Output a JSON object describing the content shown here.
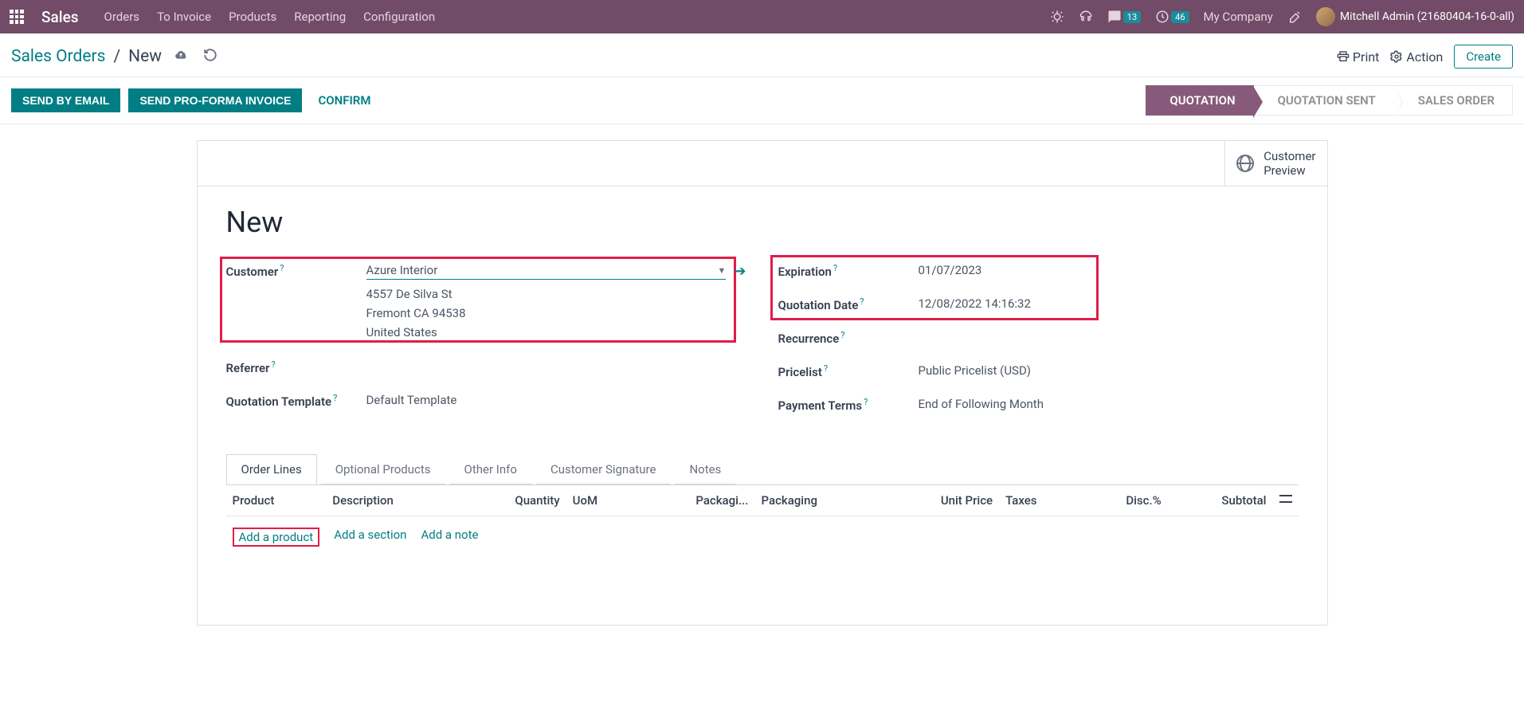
{
  "navbar": {
    "brand": "Sales",
    "links": [
      "Orders",
      "To Invoice",
      "Products",
      "Reporting",
      "Configuration"
    ],
    "chat_count": "13",
    "clock_count": "46",
    "company": "My Company",
    "user": "Mitchell Admin (21680404-16-0-all)"
  },
  "breadcrumb": {
    "root": "Sales Orders",
    "current": "New",
    "print": "Print",
    "action": "Action",
    "create": "Create"
  },
  "actions": {
    "send_email": "SEND BY EMAIL",
    "proforma": "SEND PRO-FORMA INVOICE",
    "confirm": "CONFIRM"
  },
  "status": {
    "steps": [
      "QUOTATION",
      "QUOTATION SENT",
      "SALES ORDER"
    ],
    "active": 0
  },
  "preview": {
    "line1": "Customer",
    "line2": "Preview"
  },
  "form": {
    "title": "New",
    "customer_label": "Customer",
    "customer_value": "Azure Interior",
    "address_line1": "4557 De Silva St",
    "address_line2": "Fremont CA 94538",
    "address_line3": "United States",
    "referrer_label": "Referrer",
    "template_label": "Quotation Template",
    "template_value": "Default Template",
    "expiration_label": "Expiration",
    "expiration_value": "01/07/2023",
    "quotation_date_label": "Quotation Date",
    "quotation_date_value": "12/08/2022 14:16:32",
    "recurrence_label": "Recurrence",
    "pricelist_label": "Pricelist",
    "pricelist_value": "Public Pricelist (USD)",
    "payment_terms_label": "Payment Terms",
    "payment_terms_value": "End of Following Month"
  },
  "tabs": [
    "Order Lines",
    "Optional Products",
    "Other Info",
    "Customer Signature",
    "Notes"
  ],
  "table": {
    "headers": {
      "product": "Product",
      "description": "Description",
      "quantity": "Quantity",
      "uom": "UoM",
      "packaging_qty": "Packagi...",
      "packaging": "Packaging",
      "unit_price": "Unit Price",
      "taxes": "Taxes",
      "disc": "Disc.%",
      "subtotal": "Subtotal"
    },
    "add_product": "Add a product",
    "add_section": "Add a section",
    "add_note": "Add a note"
  }
}
